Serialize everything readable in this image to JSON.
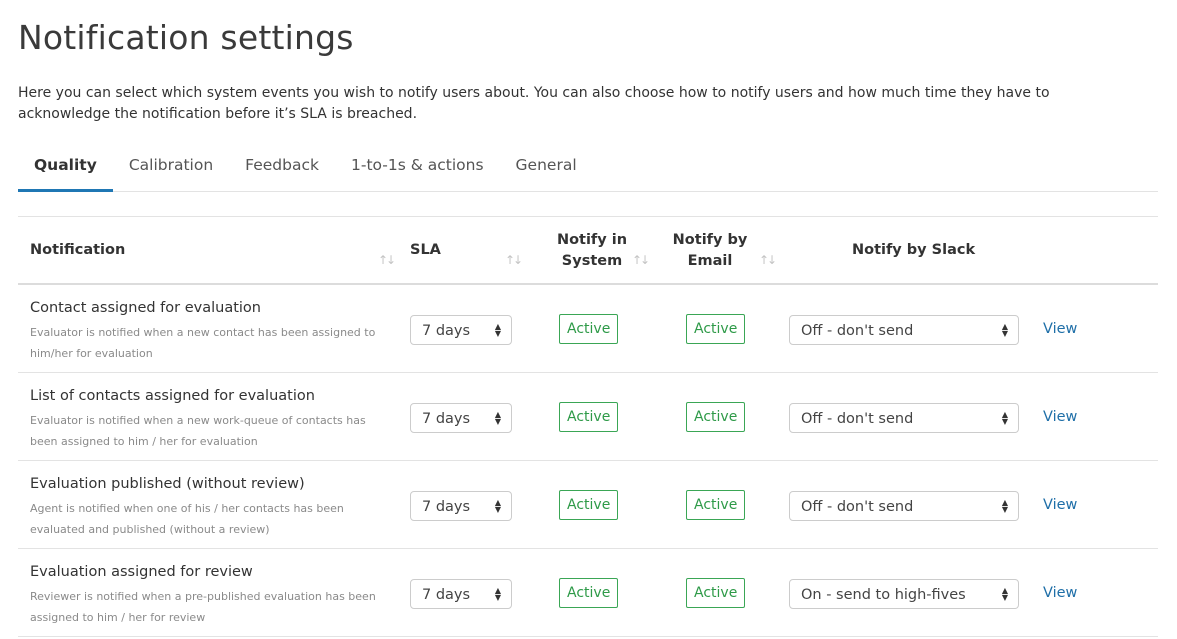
{
  "page": {
    "title": "Notification settings",
    "intro": "Here you can select which system events you wish to notify users about. You can also choose how to notify users and how much time they have to acknowledge the notification before it’s SLA is breached."
  },
  "tabs": [
    {
      "label": "Quality",
      "active": true
    },
    {
      "label": "Calibration",
      "active": false
    },
    {
      "label": "Feedback",
      "active": false
    },
    {
      "label": "1-to-1s & actions",
      "active": false
    },
    {
      "label": "General",
      "active": false
    }
  ],
  "table": {
    "headers": {
      "notification": "Notification",
      "sla": "SLA",
      "notify_system_1": "Notify in",
      "notify_system_2": "System",
      "notify_email_1": "Notify by",
      "notify_email_2": "Email",
      "notify_slack": "Notify by Slack"
    },
    "sort_icon": "↑↓",
    "select_caret_up": "▲",
    "select_caret_down": "▼",
    "rows": [
      {
        "title": "Contact assigned for evaluation",
        "description": "Evaluator is notified when a new contact has been assigned to him/her for evaluation",
        "sla": "7 days",
        "system": "Active",
        "email": "Active",
        "slack": "Off - don't send",
        "view": "View"
      },
      {
        "title": "List of contacts assigned for evaluation",
        "description": "Evaluator is notified when a new work-queue of contacts has been assigned to him / her for evaluation",
        "sla": "7 days",
        "system": "Active",
        "email": "Active",
        "slack": "Off - don't send",
        "view": "View"
      },
      {
        "title": "Evaluation published (without review)",
        "description": "Agent is notified when one of his / her contacts has been evaluated and published (without a review)",
        "sla": "7 days",
        "system": "Active",
        "email": "Active",
        "slack": "Off - don't send",
        "view": "View"
      },
      {
        "title": "Evaluation assigned for review",
        "description": "Reviewer is notified when a pre-published evaluation has been assigned to him / her for review",
        "sla": "7 days",
        "system": "Active",
        "email": "Active",
        "slack": "On - send to high-fives",
        "view": "View"
      }
    ]
  },
  "colors": {
    "accent": "#1f77b4",
    "active_green": "#3aa655",
    "link": "#1f6fa8"
  }
}
